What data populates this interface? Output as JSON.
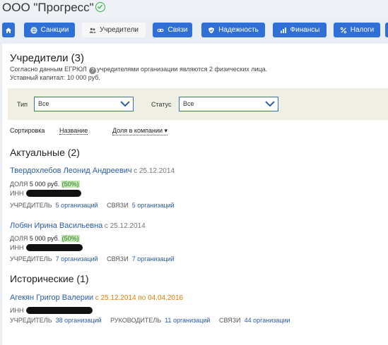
{
  "company": {
    "title": "ООО \"Прогресс\""
  },
  "nav": {
    "tabs": [
      {
        "label": "",
        "icon": "home-icon"
      },
      {
        "label": "Санкции",
        "icon": "globe-icon"
      },
      {
        "label": "Учредители",
        "icon": "people-icon",
        "active": true
      },
      {
        "label": "Связи",
        "icon": "link-icon"
      },
      {
        "label": "Надежность",
        "icon": "shield-icon"
      },
      {
        "label": "Финансы",
        "icon": "chart-icon"
      },
      {
        "label": "Налоги",
        "icon": "percent-icon"
      }
    ]
  },
  "founders": {
    "heading": "Учредители (3)",
    "desc_before": "Согласно данным ЕГРЮЛ",
    "desc_after": "учредителями организации являются 2 физических лица.",
    "capital": "Уставный капитал: 10 000 руб."
  },
  "filter": {
    "type_label": "Тип",
    "type_value": "Все",
    "status_label": "Статус",
    "status_value": "Все"
  },
  "sort": {
    "label": "Сортировка",
    "by_name": "Название",
    "by_share": "Доля в компании ▾"
  },
  "actual": {
    "heading": "Актуальные (2)",
    "people": [
      {
        "name": "Твердохлебов Леонид Андреевич",
        "since": "с 25.12.2014",
        "share_label": "ДОЛЯ",
        "share_value": "5 000 руб.",
        "share_pct": "(50%)",
        "inn_label": "ИНН",
        "role_label": "УЧРЕДИТЕЛЬ",
        "role_link": "5 организаций",
        "ties_label": "СВЯЗИ",
        "ties_link": "5 организаций"
      },
      {
        "name": "Лобян Ирина Васильевна",
        "since": "с 25.12.2014",
        "share_label": "ДОЛЯ",
        "share_value": "5 000 руб.",
        "share_pct": "(50%)",
        "inn_label": "ИНН",
        "role_label": "УЧРЕДИТЕЛЬ",
        "role_link": "7 организаций",
        "ties_label": "СВЯЗИ",
        "ties_link": "7 организаций"
      }
    ]
  },
  "historical": {
    "heading": "Исторические (1)",
    "people": [
      {
        "name": "Агекян Григор Валерии",
        "since": "с 25.12.2014 по 04.04.2016",
        "inn_label": "ИНН",
        "role_label": "УЧРЕДИТЕЛЬ",
        "role_link": "38 организаций",
        "head_label": "РУКОВОДИТЕЛЬ",
        "head_link": "11 организаций",
        "ties_label": "СВЯЗИ",
        "ties_link": "44 организации"
      }
    ]
  }
}
